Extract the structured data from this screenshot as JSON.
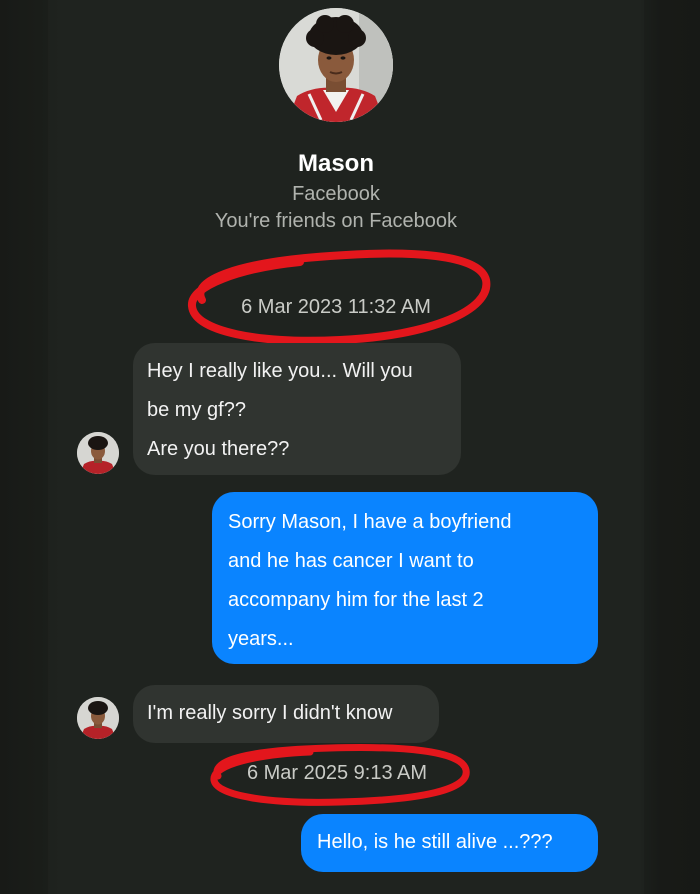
{
  "contact": {
    "name": "Mason",
    "source": "Facebook",
    "status": "You're friends on Facebook"
  },
  "timestamps": {
    "first": "6 Mar 2023 11:32 AM",
    "second": "6 Mar 2025 9:13 AM"
  },
  "messages": {
    "incoming_1": {
      "lines": [
        "Hey I really like you... Will you",
        "be my gf??",
        "Are you there??"
      ]
    },
    "outgoing_1": {
      "lines": [
        "Sorry Mason, I have a boyfriend",
        "and he has cancer I want to",
        "accompany him for the last 2",
        "years..."
      ]
    },
    "incoming_2": {
      "lines": [
        "I'm really sorry I didn't know"
      ]
    },
    "outgoing_2": {
      "lines": [
        "Hello, is he still alive ...???"
      ]
    }
  },
  "colors": {
    "background": "#1f231f",
    "incoming_bubble": "#303430",
    "outgoing_bubble": "#0a84ff",
    "annotation_red": "#e3161c"
  },
  "icons": {
    "header_avatar": "profile-photo",
    "message_avatar": "profile-photo-small"
  }
}
